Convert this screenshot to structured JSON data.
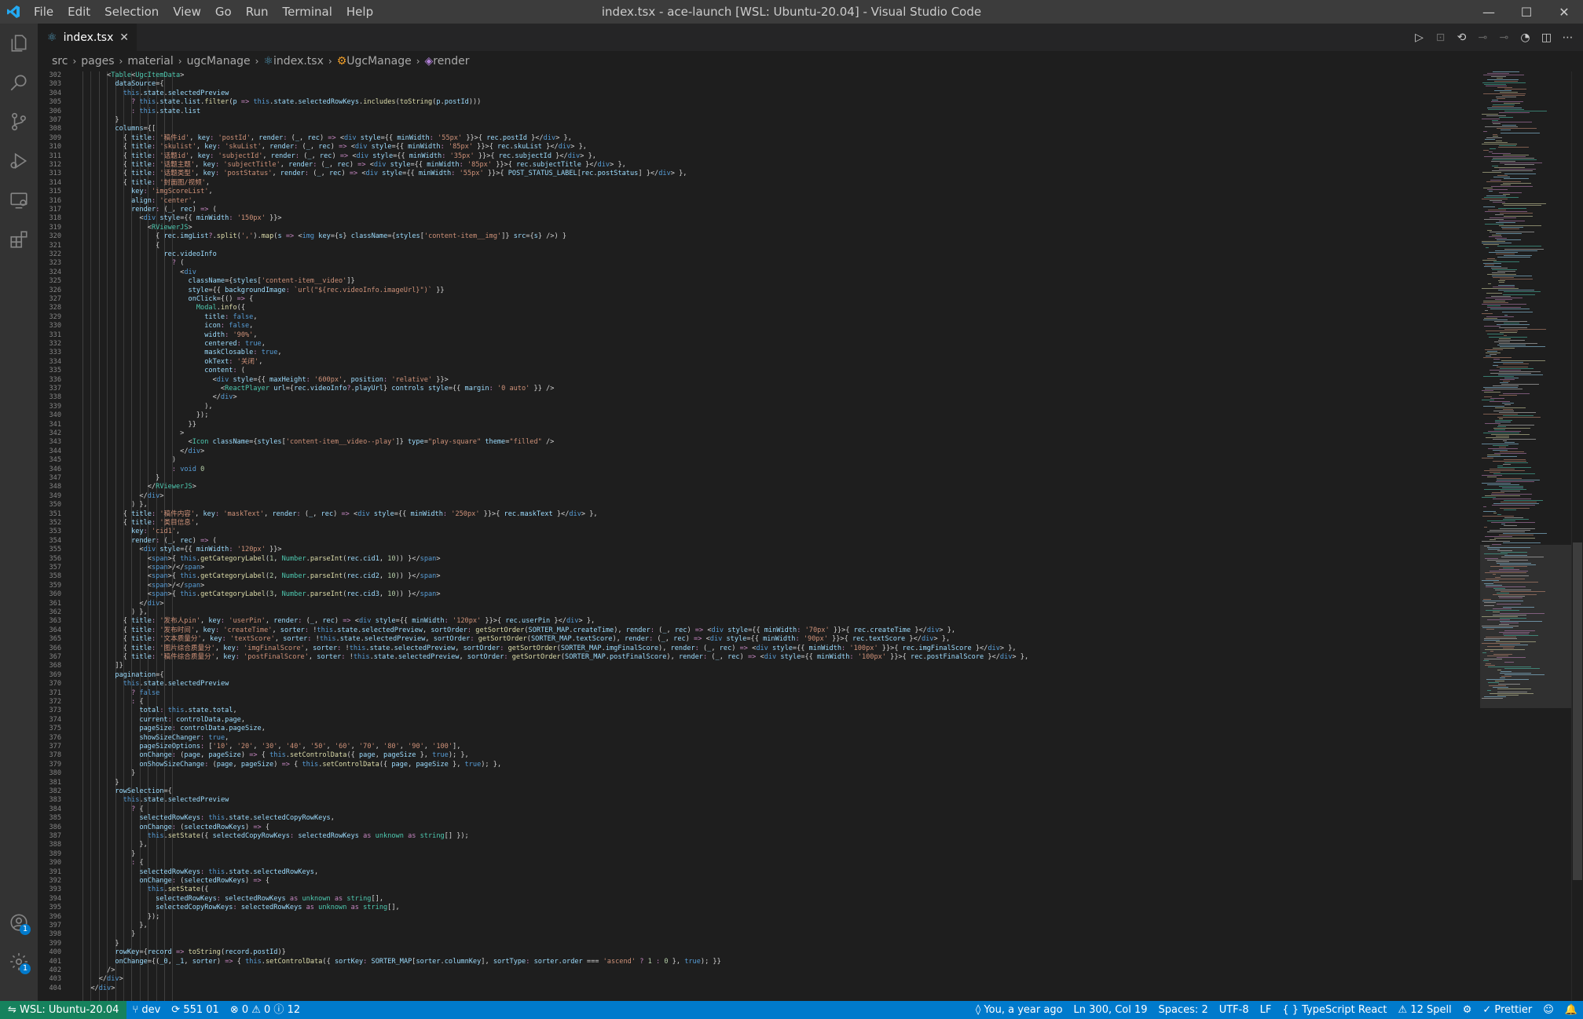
{
  "titlebar": {
    "menu": [
      "File",
      "Edit",
      "Selection",
      "View",
      "Go",
      "Run",
      "Terminal",
      "Help"
    ],
    "title": "index.tsx - ace-launch [WSL: Ubuntu-20.04] - Visual Studio Code"
  },
  "tab": {
    "label": "index.tsx",
    "icon": "react-icon"
  },
  "breadcrumbs": [
    "src",
    "pages",
    "material",
    "ugcManage",
    "index.tsx",
    "UgcManage",
    "render"
  ],
  "activity": {
    "accounts_badge": "1",
    "settings_badge": "1"
  },
  "colors": {
    "keyword": "#c586c0",
    "string": "#ce9178",
    "variable": "#9cdcfe",
    "function": "#dcdcaa",
    "type": "#4ec9b0",
    "constant": "#569cd6",
    "number": "#b5cea8",
    "plain": "#d4d4d4"
  },
  "editor": {
    "first_line": 302,
    "lines": [
      "      <Table<UgcItemData>",
      "        dataSource={",
      "          this.state.selectedPreview",
      "            ? this.state.list.filter(p => this.state.selectedRowKeys.includes(toString(p.postId)))",
      "            : this.state.list",
      "        }",
      "        columns={[",
      "          { title: '稿件id', key: 'postId', render: (_, rec) => <div style={{ minWidth: '55px' }}>{ rec.postId }</div> },",
      "          { title: 'skulist', key: 'skuList', render: (_, rec) => <div style={{ minWidth: '85px' }}>{ rec.skuList }</div> },",
      "          { title: '话题id', key: 'subjectId', render: (_, rec) => <div style={{ minWidth: '35px' }}>{ rec.subjectId }</div> },",
      "          { title: '话题主题', key: 'subjectTitle', render: (_, rec) => <div style={{ minWidth: '85px' }}>{ rec.subjectTitle }</div> },",
      "          { title: '话题类型', key: 'postStatus', render: (_, rec) => <div style={{ minWidth: '55px' }}>{ POST_STATUS_LABEL[rec.postStatus] }</div> },",
      "          { title: '封面图/视频',",
      "            key: 'imgScoreList',",
      "            align: 'center',",
      "            render: (_, rec) => (",
      "              <div style={{ minWidth: '150px' }}>",
      "                <RViewerJS>",
      "                  { rec.imgList?.split(',').map(s => <img key={s} className={styles['content-item__img']} src={s} />) }",
      "                  {",
      "                    rec.videoInfo",
      "                      ? (",
      "                        <div",
      "                          className={styles['content-item__video']}",
      "                          style={{ backgroundImage: `url(\"${rec.videoInfo.imageUrl}\")` }}",
      "                          onClick={() => {",
      "                            Modal.info({",
      "                              title: false,",
      "                              icon: false,",
      "                              width: '90%',",
      "                              centered: true,",
      "                              maskClosable: true,",
      "                              okText: '关闭',",
      "                              content: (",
      "                                <div style={{ maxHeight: '600px', position: 'relative' }}>",
      "                                  <ReactPlayer url={rec.videoInfo?.playUrl} controls style={{ margin: '0 auto' }} />",
      "                                </div>",
      "                              ),",
      "                            });",
      "                          }}",
      "                        >",
      "                          <Icon className={styles['content-item__video--play']} type=\"play-square\" theme=\"filled\" />",
      "                        </div>",
      "                      )",
      "                      : void 0",
      "                  }",
      "                </RViewerJS>",
      "              </div>",
      "            ) },",
      "          { title: '稿件内容', key: 'maskText', render: (_, rec) => <div style={{ minWidth: '250px' }}>{ rec.maskText }</div> },",
      "          { title: '类目信息',",
      "            key: 'cid1',",
      "            render: (_, rec) => (",
      "              <div style={{ minWidth: '120px' }}>",
      "                <span>{ this.getCategoryLabel(1, Number.parseInt(rec.cid1, 10)) }</span>",
      "                <span>/</span>",
      "                <span>{ this.getCategoryLabel(2, Number.parseInt(rec.cid2, 10)) }</span>",
      "                <span>/</span>",
      "                <span>{ this.getCategoryLabel(3, Number.parseInt(rec.cid3, 10)) }</span>",
      "              </div>",
      "            ) },",
      "          { title: '发布人pin', key: 'userPin', render: (_, rec) => <div style={{ minWidth: '120px' }}>{ rec.userPin }</div> },",
      "          { title: '发布时间', key: 'createTime', sorter: !this.state.selectedPreview, sortOrder: getSortOrder(SORTER_MAP.createTime), render: (_, rec) => <div style={{ minWidth: '70px' }}>{ rec.createTime }</div> },",
      "          { title: '文本质量分', key: 'textScore', sorter: !this.state.selectedPreview, sortOrder: getSortOrder(SORTER_MAP.textScore), render: (_, rec) => <div style={{ minWidth: '90px' }}>{ rec.textScore }</div> },",
      "          { title: '图片综合质量分', key: 'imgFinalScore', sorter: !this.state.selectedPreview, sortOrder: getSortOrder(SORTER_MAP.imgFinalScore), render: (_, rec) => <div style={{ minWidth: '100px' }}>{ rec.imgFinalScore }</div> },",
      "          { title: '稿件综合质量分', key: 'postFinalScore', sorter: !this.state.selectedPreview, sortOrder: getSortOrder(SORTER_MAP.postFinalScore), render: (_, rec) => <div style={{ minWidth: '100px' }}>{ rec.postFinalScore }</div> },",
      "        ]}",
      "        pagination={",
      "          this.state.selectedPreview",
      "            ? false",
      "            : {",
      "              total: this.state.total,",
      "              current: controlData.page,",
      "              pageSize: controlData.pageSize,",
      "              showSizeChanger: true,",
      "              pageSizeOptions: ['10', '20', '30', '40', '50', '60', '70', '80', '90', '100'],",
      "              onChange: (page, pageSize) => { this.setControlData({ page, pageSize }, true); },",
      "              onShowSizeChange: (page, pageSize) => { this.setControlData({ page, pageSize }, true); },",
      "            }",
      "        }",
      "        rowSelection={",
      "          this.state.selectedPreview",
      "            ? {",
      "              selectedRowKeys: this.state.selectedCopyRowKeys,",
      "              onChange: (selectedRowKeys) => {",
      "                this.setState({ selectedCopyRowKeys: selectedRowKeys as unknown as string[] });",
      "              },",
      "            }",
      "            : {",
      "              selectedRowKeys: this.state.selectedRowKeys,",
      "              onChange: (selectedRowKeys) => {",
      "                this.setState({",
      "                  selectedRowKeys: selectedRowKeys as unknown as string[],",
      "                  selectedCopyRowKeys: selectedRowKeys as unknown as string[],",
      "                });",
      "              },",
      "            }",
      "        }",
      "        rowKey={record => toString(record.postId)}",
      "        onChange={(_0, _1, sorter) => { this.setControlData({ sortKey: SORTER_MAP[sorter.columnKey], sortType: sorter.order === 'ascend' ? 1 : 0 }, true); }}",
      "      />",
      "    </div>",
      "  </div>"
    ]
  },
  "statusbar": {
    "remote": "WSL: Ubuntu-20.04",
    "branch": "dev",
    "sync": "551 01",
    "problems": "⊗ 0 ⚠ 0 ⓘ 12",
    "blame": "You, a year ago",
    "position": "Ln 300, Col 19",
    "spaces": "Spaces: 2",
    "encoding": "UTF-8",
    "eol": "LF",
    "language": "TypeScript React",
    "spell": "12 Spell",
    "prettier": "Prettier"
  }
}
